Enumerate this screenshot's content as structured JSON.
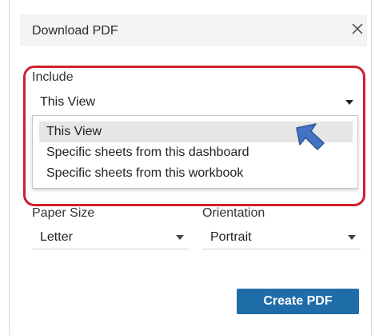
{
  "dialog": {
    "title": "Download PDF"
  },
  "include": {
    "label": "Include",
    "selected": "This View",
    "options": [
      "This View",
      "Specific sheets from this dashboard",
      "Specific sheets from this workbook"
    ]
  },
  "paper_size": {
    "label": "Paper Size",
    "selected": "Letter"
  },
  "orientation": {
    "label": "Orientation",
    "selected": "Portrait"
  },
  "actions": {
    "create_label": "Create PDF"
  },
  "colors": {
    "primary_button": "#1f6da8",
    "annotation_ring": "#d0202c",
    "annotation_arrow": "#4472c4",
    "selected_option_bg": "#e6e6e6"
  },
  "icons": {
    "close": "close-icon",
    "dropdown": "chevron-down-icon",
    "pointer": "arrow-pointer-icon"
  }
}
